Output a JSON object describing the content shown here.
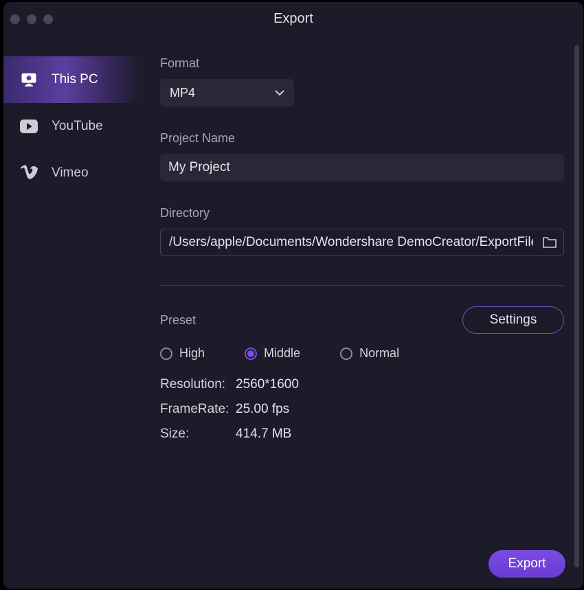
{
  "title": "Export",
  "sidebar": {
    "items": [
      {
        "label": "This PC"
      },
      {
        "label": "YouTube"
      },
      {
        "label": "Vimeo"
      }
    ]
  },
  "format": {
    "label": "Format",
    "value": "MP4"
  },
  "project_name": {
    "label": "Project Name",
    "value": "My Project"
  },
  "directory": {
    "label": "Directory",
    "value": "/Users/apple/Documents/Wondershare DemoCreator/ExportFiles"
  },
  "preset": {
    "label": "Preset",
    "settings_label": "Settings",
    "options": {
      "high": "High",
      "middle": "Middle",
      "normal": "Normal"
    }
  },
  "info": {
    "resolution_label": "Resolution:",
    "resolution_value": "2560*1600",
    "framerate_label": "FrameRate:",
    "framerate_value": "25.00 fps",
    "size_label": "Size:",
    "size_value": "414.7 MB"
  },
  "export_button": "Export"
}
